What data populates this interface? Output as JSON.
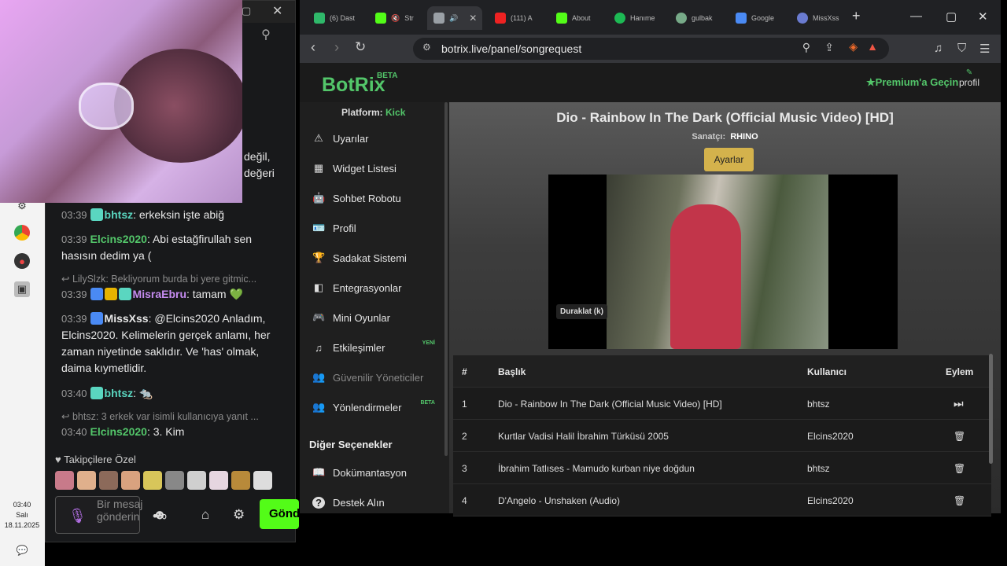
{
  "taskbar": {
    "time": "03:40",
    "day": "Salı",
    "date": "18.11.2025"
  },
  "chat": {
    "messages": [
      {
        "time": "03:39",
        "user": "bhtsz",
        "user_color": "#5ad6c0",
        "text": ": erkeksin işte abiğ"
      },
      {
        "time": "03:39",
        "user": "Elcins2020",
        "user_color": "#53c66a",
        "text": ": Abi estağfirullah sen hasısın dedim ya ("
      },
      {
        "reply": "LilySlzk: Bekliyorum burda bi yere gitmic..."
      },
      {
        "time": "03:39",
        "user": "MisraEbru",
        "user_color": "#c58cf0",
        "text": ": tamam 💚"
      },
      {
        "time": "03:39",
        "user": "MissXss",
        "user_color": "#e8e8e8",
        "text": ": @Elcins2020 Anladım, Elcins2020. Kelimelerin gerçek anlamı, her zaman niyetinde saklıdır. Ve 'has' olmak, daima kıymetlidir."
      },
      {
        "time": "03:40",
        "user": "bhtsz",
        "user_color": "#5ad6c0",
        "text": ": 🐀"
      },
      {
        "reply": "bhtsz: 3 erkek var isimli kullanıcıya yanıt ..."
      },
      {
        "time": "03:40",
        "user": "Elcins2020",
        "user_color": "#53c66a",
        "text": ": 3. Kim"
      }
    ],
    "partial_top": [
      "değil,",
      "değeri"
    ],
    "follower_only": "Takipçilere Özel",
    "input_placeholder": "Bir mesaj gönderin",
    "send_label": "Gönder"
  },
  "browser": {
    "tabs": [
      {
        "label": "(6) Dast",
        "color": "#2fb86a"
      },
      {
        "label": "Str",
        "color": "#53fc18"
      },
      {
        "label": "",
        "color": "#9aa0a6",
        "active": true
      },
      {
        "label": "(111) A",
        "color": "#e22"
      },
      {
        "label": "About",
        "color": "#53fc18"
      },
      {
        "label": "Hanıme",
        "color": "#1db954"
      },
      {
        "label": "gulbak",
        "color": "#7a8"
      },
      {
        "label": "Google",
        "color": "#4a8af4"
      },
      {
        "label": "MissXss",
        "color": "#6a7bd0"
      }
    ],
    "url": "botrix.live/panel/songrequest"
  },
  "site": {
    "logo": "BotRix",
    "logo_badge": "BETA",
    "premium": "Premium'a Geçin",
    "profile": "profil",
    "platform_label": "Platform:",
    "platform_value": "Kick",
    "menu": [
      {
        "label": "Uyarılar",
        "icon": "warning-icon",
        "glyph": "⚠"
      },
      {
        "label": "Widget Listesi",
        "icon": "grid-icon",
        "glyph": "▦"
      },
      {
        "label": "Sohbet Robotu",
        "icon": "robot-icon",
        "glyph": "🤖"
      },
      {
        "label": "Profil",
        "icon": "id-card-icon",
        "glyph": "🪪"
      },
      {
        "label": "Sadakat Sistemi",
        "icon": "trophy-icon",
        "glyph": "🏆"
      },
      {
        "label": "Entegrasyonlar",
        "icon": "integration-icon",
        "glyph": "◧"
      },
      {
        "label": "Mini Oyunlar",
        "icon": "gamepad-icon",
        "glyph": "🎮"
      },
      {
        "label": "Etkileşimler",
        "icon": "music-icon",
        "glyph": "♫",
        "badge": "YENİ"
      },
      {
        "label": "Güvenilir Yöneticiler",
        "icon": "users-cog-icon",
        "glyph": "👥",
        "muted": true
      },
      {
        "label": "Yönlendirmeler",
        "icon": "users-icon",
        "glyph": "👥",
        "badge": "BETA"
      }
    ],
    "other_heading": "Diğer Seçenekler",
    "other_menu": [
      {
        "label": "Dokümantasyon",
        "icon": "book-icon",
        "glyph": "📖"
      },
      {
        "label": "Destek Alın",
        "icon": "question-icon",
        "glyph": "?"
      }
    ],
    "now_playing": {
      "title": "Dio - Rainbow In The Dark (Official Music Video) [HD]",
      "artist_label": "Sanatçı:",
      "artist": "RHINO",
      "settings": "Ayarlar",
      "pause_tooltip": "Duraklat (k)"
    },
    "queue": {
      "headers": [
        "#",
        "Başlık",
        "Kullanıcı",
        "Eylem"
      ],
      "rows": [
        {
          "n": "1",
          "title": "Dio - Rainbow In The Dark (Official Music Video) [HD]",
          "user": "bhtsz",
          "action": "⏭"
        },
        {
          "n": "2",
          "title": "Kurtlar Vadisi Halil İbrahim Türküsü 2005",
          "user": "Elcins2020",
          "action": "🗑"
        },
        {
          "n": "3",
          "title": "İbrahim Tatlıses - Mamudo kurban niye doğdun",
          "user": "bhtsz",
          "action": "🗑"
        },
        {
          "n": "4",
          "title": "D'Angelo - Unshaken (Audio)",
          "user": "Elcins2020",
          "action": "🗑"
        }
      ]
    }
  }
}
